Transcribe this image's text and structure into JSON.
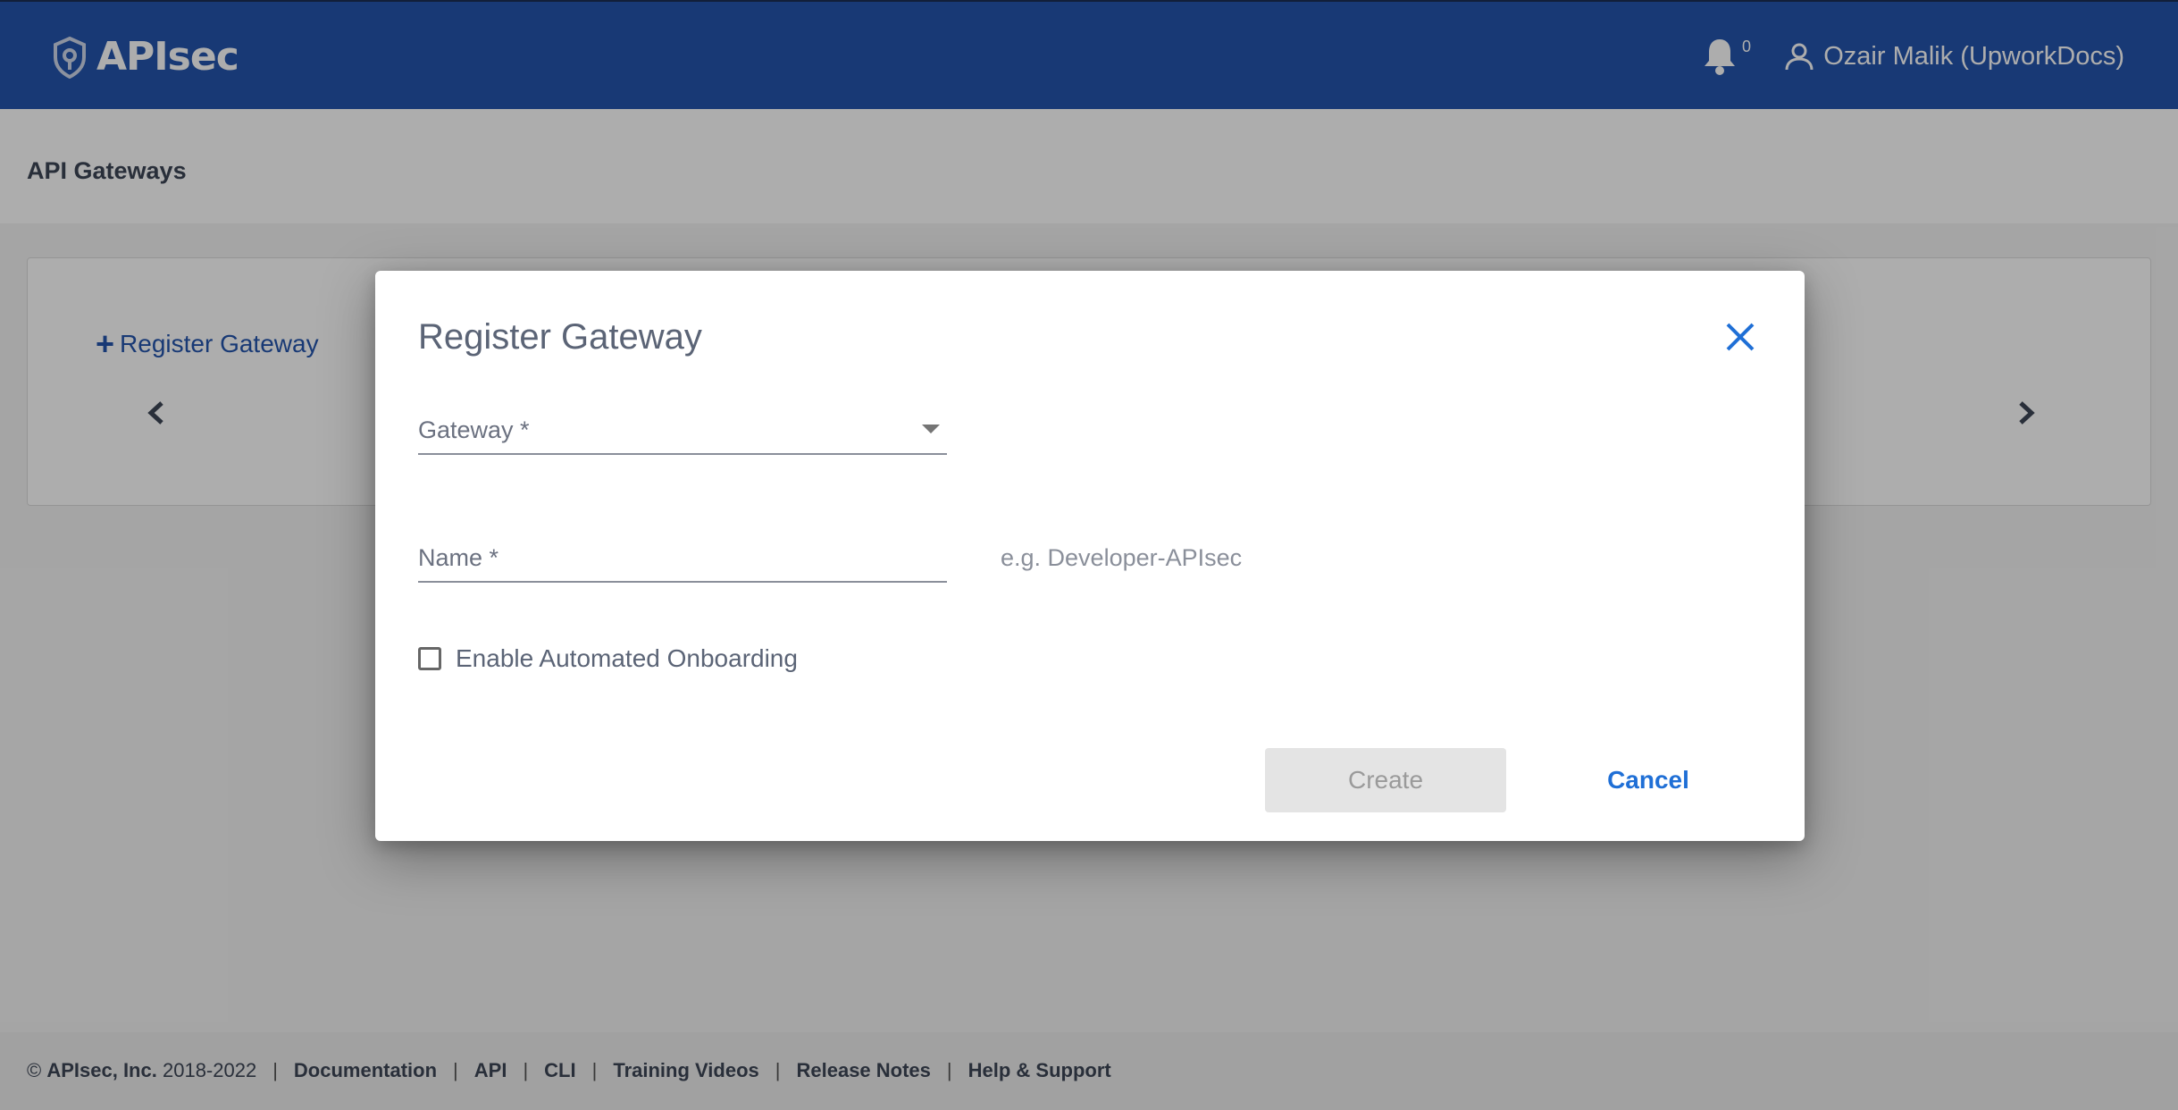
{
  "header": {
    "brand": "APIsec",
    "notification_count": "0",
    "user_name": "Ozair Malik (UpworkDocs)"
  },
  "page": {
    "title": "API Gateways",
    "register_link": "Register Gateway"
  },
  "modal": {
    "title": "Register Gateway",
    "gateway_label": "Gateway *",
    "name_label": "Name *",
    "name_hint": "e.g. Developer-APIsec",
    "onboarding_label": "Enable Automated Onboarding",
    "onboarding_checked": false,
    "create_label": "Create",
    "cancel_label": "Cancel"
  },
  "footer": {
    "copyright_symbol": "©",
    "company": "APIsec, Inc.",
    "years": "2018-2022",
    "links": [
      "Documentation",
      "API",
      "CLI",
      "Training Videos",
      "Release Notes",
      "Help & Support"
    ]
  },
  "colors": {
    "header_bg": "#2455ad",
    "link": "#2455ad",
    "primary": "#1f6fd6"
  }
}
